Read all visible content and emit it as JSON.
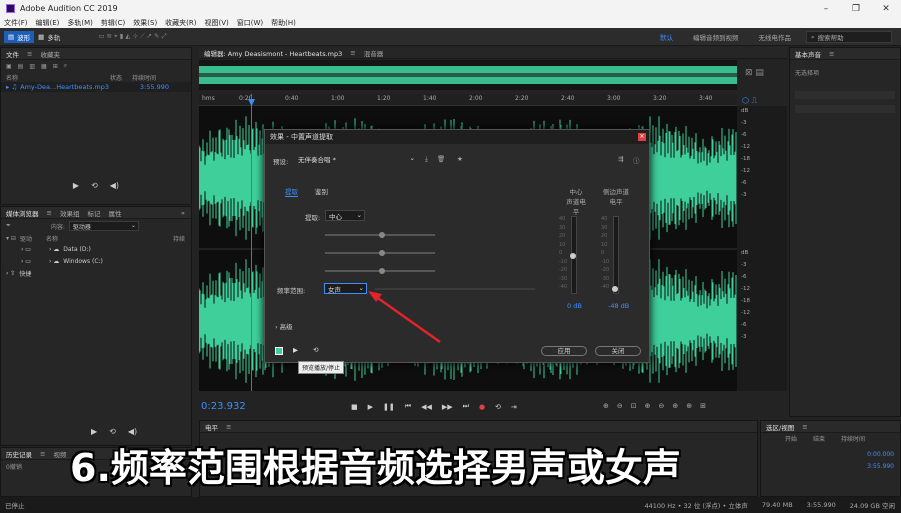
{
  "window": {
    "title": "Adobe Audition CC 2019"
  },
  "menu": [
    "文件(F)",
    "编辑(E)",
    "多轨(M)",
    "剪辑(C)",
    "效果(S)",
    "收藏夹(R)",
    "视图(V)",
    "窗口(W)",
    "帮助(H)"
  ],
  "toolbar": {
    "waveform": "波形",
    "multitrack": "多轨"
  },
  "workspaces": [
    "默认",
    "编辑音频到视频",
    "无线电作品"
  ],
  "search": {
    "placeholder": "搜索帮助"
  },
  "files_panel": {
    "tabs": [
      "文件",
      "收藏夹"
    ],
    "col_name": "名称",
    "col_status": "状态",
    "col_duration": "持续时间",
    "file_name": "Amy-Dea...Heartbeats.mp3",
    "file_duration": "3:55.990"
  },
  "browser_panel": {
    "tabs": [
      "媒体浏览器",
      "效果组",
      "标记",
      "属性"
    ],
    "content_label": "内容:",
    "content_value": "驱动器",
    "col_name": "名称",
    "col_duration": "持续",
    "tree_items": [
      "驱动",
      "快捷"
    ],
    "drives": [
      "Data (D:)",
      "Windows (C:)"
    ]
  },
  "editor": {
    "tab": "编辑器: Amy Deasismont - Heartbeats.mp3",
    "mixer_tab": "混音器",
    "ruler_unit": "hms",
    "ruler_ticks": [
      "0:20",
      "0:40",
      "1:00",
      "1:20",
      "1:40",
      "2:00",
      "2:20",
      "2:40",
      "3:00",
      "3:20",
      "3:40"
    ],
    "time": "0:23.932"
  },
  "db_scale": {
    "top": [
      "dB",
      "-3",
      "-6",
      "-12",
      "-18",
      "-12",
      "-6",
      "-3"
    ],
    "bottom": [
      "dB",
      "-3",
      "-6",
      "-12",
      "-18",
      "-12",
      "-6",
      "-3"
    ]
  },
  "right_panel": {
    "title": "基本声音",
    "subtitle": "无选择项"
  },
  "dialog": {
    "title": "效果 - 中置声道提取",
    "preset_label": "预设:",
    "preset_value": "无伴奏合唱 *",
    "tabs": [
      "提取",
      "鉴别"
    ],
    "extract_label": "提取:",
    "extract_value": "中心",
    "freq_label": "频率范围:",
    "freq_value": "女声",
    "advanced_label": "高级",
    "center_label": "中心\n声道电平",
    "side_label": "侧边声道\n电平",
    "center_value": "0 dB",
    "side_value": "-48 dB",
    "meter_labels": [
      "40",
      "30",
      "20",
      "10",
      "0",
      "-10",
      "-20",
      "-30",
      "-40"
    ],
    "apply_button": "应用",
    "close_button": "关闭",
    "tooltip": "预览播放/停止"
  },
  "level_panel": {
    "title": "电平"
  },
  "selection_panel": {
    "title": "选区/视图",
    "col_start": "开始",
    "col_end": "结束",
    "col_duration": "持续时间",
    "v1": "0:00.000",
    "v2": "3:55.990"
  },
  "history_panel": {
    "tabs": [
      "历史记录",
      "视频"
    ],
    "item": "0撤销"
  },
  "caption": "6.频率范围根据音频选择男声或女声",
  "status": {
    "left": "已停止",
    "format": "44100 Hz • 32 位 (浮点) • 立体声",
    "size": "79.40 MB",
    "duration": "3:55.990",
    "free": "24.09 GB 空闲"
  },
  "colors": {
    "waveform": "#3ecf9b",
    "accent": "#3d8fff",
    "playhead": "#e04040"
  }
}
